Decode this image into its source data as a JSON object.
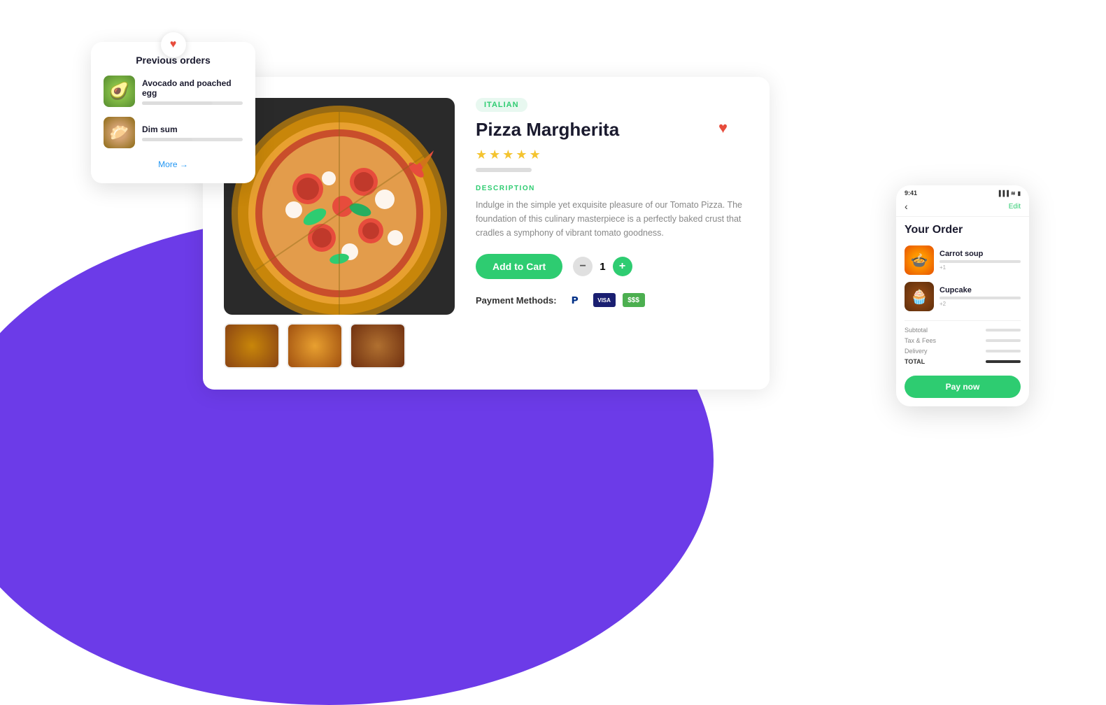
{
  "background": {
    "circle_color": "#6c3be8"
  },
  "previous_orders_card": {
    "heart_icon": "♥",
    "title": "Previous orders",
    "more_text": "More →",
    "items": [
      {
        "name": "Avocado and poached egg",
        "emoji": "🥑",
        "bar_width": "70%"
      },
      {
        "name": "Dim sum",
        "emoji": "🥟",
        "bar_width": "50%"
      }
    ]
  },
  "product": {
    "category": "ITALIAN",
    "title": "Pizza Margherita",
    "stars": 4.5,
    "favorite_icon": "♥",
    "description_label": "DESCRIPTION",
    "description": "Indulge in the simple yet exquisite pleasure of our Tomato Pizza. The foundation of this culinary masterpiece is a perfectly baked crust that cradles a symphony of vibrant tomato goodness.",
    "add_to_cart_label": "Add to Cart",
    "quantity": "1",
    "minus_icon": "−",
    "plus_icon": "+",
    "payment_label": "Payment Methods:",
    "payment_methods": [
      "PayPal",
      "Visa",
      "Cash"
    ]
  },
  "mobile_order": {
    "time": "9:41",
    "signal_icon": "▪▪▪",
    "wifi_icon": "WiFi",
    "battery_icon": "🔋",
    "back_icon": "‹",
    "edit_label": "Edit",
    "title": "Your Order",
    "items": [
      {
        "name": "Carrot soup",
        "emoji": "🍲",
        "sub": "+1"
      },
      {
        "name": "Cupcake",
        "emoji": "🧁",
        "sub": "+2"
      }
    ],
    "totals": [
      {
        "label": "Subtotal"
      },
      {
        "label": "Tax & Fees"
      },
      {
        "label": "Delivery"
      },
      {
        "label": "TOTAL",
        "bold": true
      }
    ],
    "pay_button": "Pay now"
  }
}
